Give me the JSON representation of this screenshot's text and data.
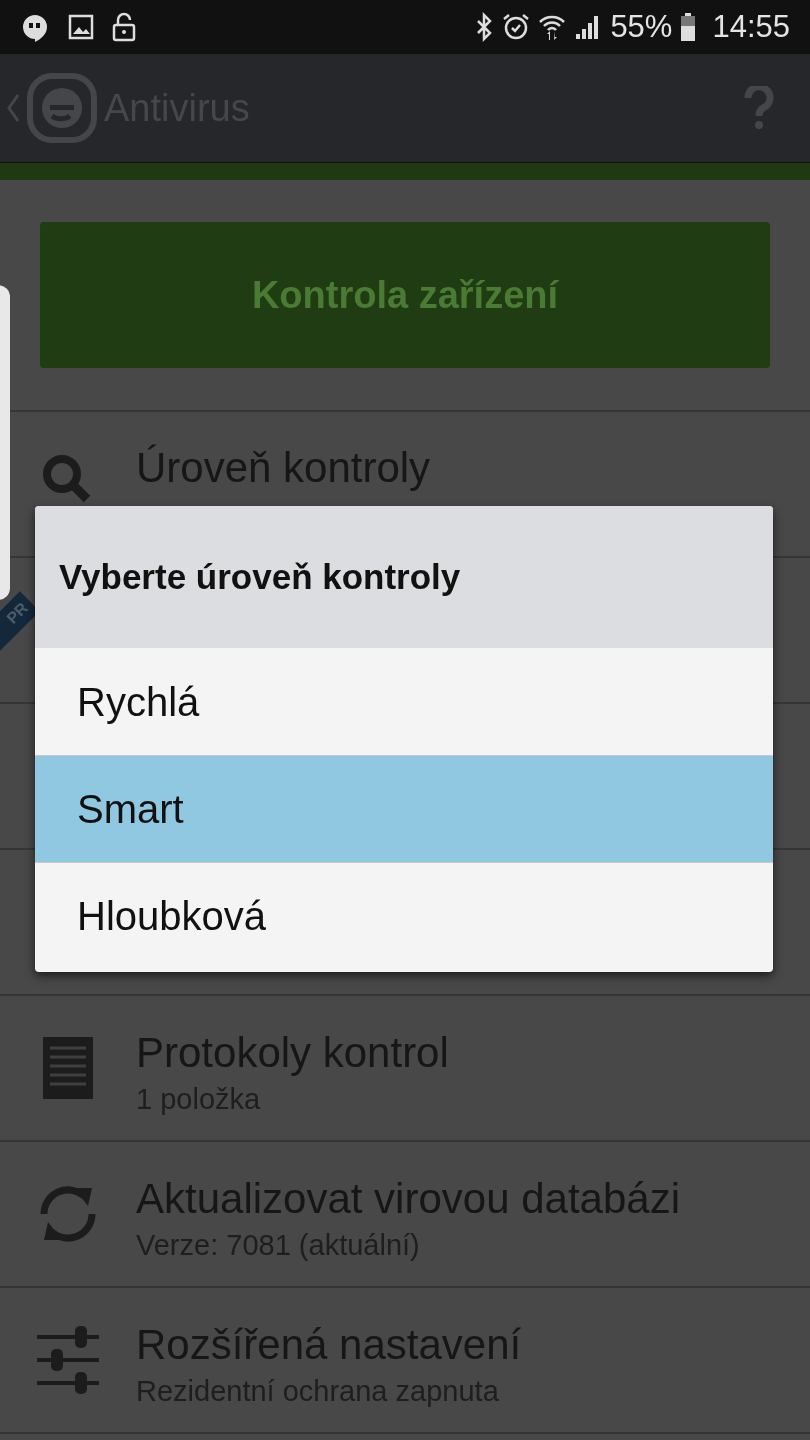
{
  "status_bar": {
    "battery": "55%",
    "time": "14:55"
  },
  "app_bar": {
    "title": "Antivirus"
  },
  "scan_button": {
    "label": "Kontrola zařízení"
  },
  "side_panel": {
    "ribbon": "PR"
  },
  "settings": [
    {
      "kind": "search",
      "title": "Úroveň kontroly"
    },
    {
      "kind": "hidden"
    },
    {
      "kind": "hidden"
    },
    {
      "kind": "hidden"
    },
    {
      "kind": "log",
      "title": "Protokoly kontrol",
      "subtitle": "1 položka"
    },
    {
      "kind": "update",
      "title": "Aktualizovat virovou databázi",
      "subtitle": "Verze: 7081 (aktuální)"
    },
    {
      "kind": "tune",
      "title": "Rozšířená nastavení",
      "subtitle": "Rezidentní ochrana zapnuta"
    }
  ],
  "dialog": {
    "title": "Vyberte úroveň kontroly",
    "options": [
      {
        "label": "Rychlá",
        "selected": false
      },
      {
        "label": "Smart",
        "selected": true
      },
      {
        "label": "Hloubková",
        "selected": false
      }
    ]
  }
}
